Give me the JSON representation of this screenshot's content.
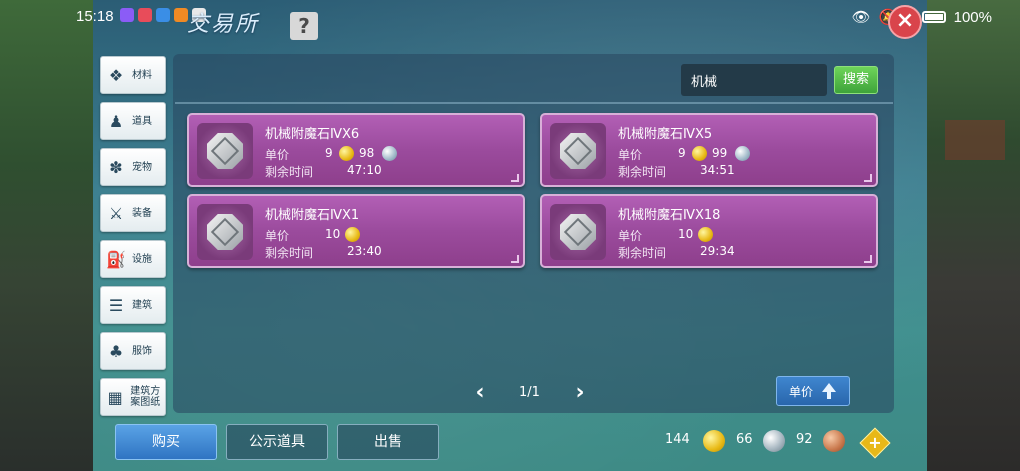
{
  "status_bar": {
    "time": "15:18",
    "battery": "100%"
  },
  "window": {
    "title": "交易所",
    "help_label": "?",
    "close_label": "×"
  },
  "sidebar": {
    "items": [
      {
        "label": "材料",
        "icon": "materials-icon"
      },
      {
        "label": "道具",
        "icon": "props-icon"
      },
      {
        "label": "宠物",
        "icon": "pet-paw-icon"
      },
      {
        "label": "装备",
        "icon": "equipment-icon"
      },
      {
        "label": "设施",
        "icon": "facility-icon"
      },
      {
        "label": "建筑",
        "icon": "building-icon"
      },
      {
        "label": "服饰",
        "icon": "clothing-icon"
      },
      {
        "label": "建筑方案图纸",
        "icon": "blueprint-icon"
      }
    ]
  },
  "search": {
    "value": "机械",
    "button_label": "搜索"
  },
  "listings": [
    {
      "name": "机械附魔石ⅣX6",
      "price_label": "单价",
      "gold": "9",
      "silver": "98",
      "time_label": "剩余时间",
      "time": "47:10"
    },
    {
      "name": "机械附魔石ⅣX5",
      "price_label": "单价",
      "gold": "9",
      "silver": "99",
      "time_label": "剩余时间",
      "time": "34:51"
    },
    {
      "name": "机械附魔石ⅣX1",
      "price_label": "单价",
      "gold": "10",
      "silver": "",
      "time_label": "剩余时间",
      "time": "23:40"
    },
    {
      "name": "机械附魔石ⅣX18",
      "price_label": "单价",
      "gold": "10",
      "silver": "",
      "time_label": "剩余时间",
      "time": "29:34"
    }
  ],
  "pager": {
    "text": "1/1",
    "prev": "‹",
    "next": "›"
  },
  "sort": {
    "label": "单价"
  },
  "bottom_tabs": {
    "buy": "购买",
    "public": "公示道具",
    "sell": "出售"
  },
  "currency": {
    "gold": "144",
    "silver": "66",
    "copper": "92",
    "add": "+"
  }
}
